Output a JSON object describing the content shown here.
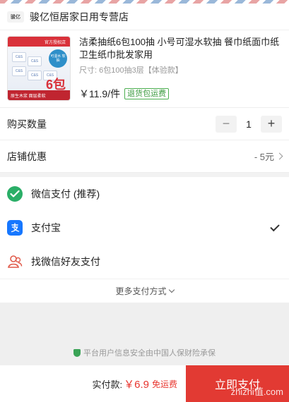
{
  "shop": {
    "logo_text": "骏亿",
    "name": "骏亿恒居家日用专营店"
  },
  "product": {
    "title": "洁柔抽纸6包100抽 小号可湿水软抽 餐巾纸面巾纸卫生纸巾批发家用",
    "spec": "尺寸: 6包100抽3层【体验款】",
    "price": "￥11.9/件",
    "tag": "退货包运费",
    "thumb": {
      "band_top": "官方授权店",
      "seal": "可湿水 软抽",
      "box_text": "C&S",
      "big_number": "6包",
      "band_bottom": "原生木浆 面层柔软"
    }
  },
  "quantity": {
    "label": "购买数量",
    "minus": "−",
    "value": "1",
    "plus": "+"
  },
  "discount": {
    "label": "店铺优惠",
    "value": "- 5元"
  },
  "payments": [
    {
      "label": "微信支付 (推荐)",
      "icon": "wechat-pay-icon",
      "color": "#2aae67",
      "selected": false
    },
    {
      "label": "支付宝",
      "icon": "alipay-icon",
      "color": "#1677ff",
      "selected": true
    },
    {
      "label": "找微信好友支付",
      "icon": "friend-pay-icon",
      "color": "#e05a4a",
      "selected": false
    }
  ],
  "more_payments": "更多支付方式",
  "security_note": "平台用户信息安全由中国人保财险承保",
  "footer": {
    "total_label": "实付款:",
    "total_price": "￥6.9",
    "shipping": "免运费",
    "pay_button": "立即支付"
  },
  "watermark": "zhizhi值.com",
  "colors": {
    "accent": "#e23a33",
    "wechat": "#2aae67",
    "alipay": "#1677ff"
  }
}
